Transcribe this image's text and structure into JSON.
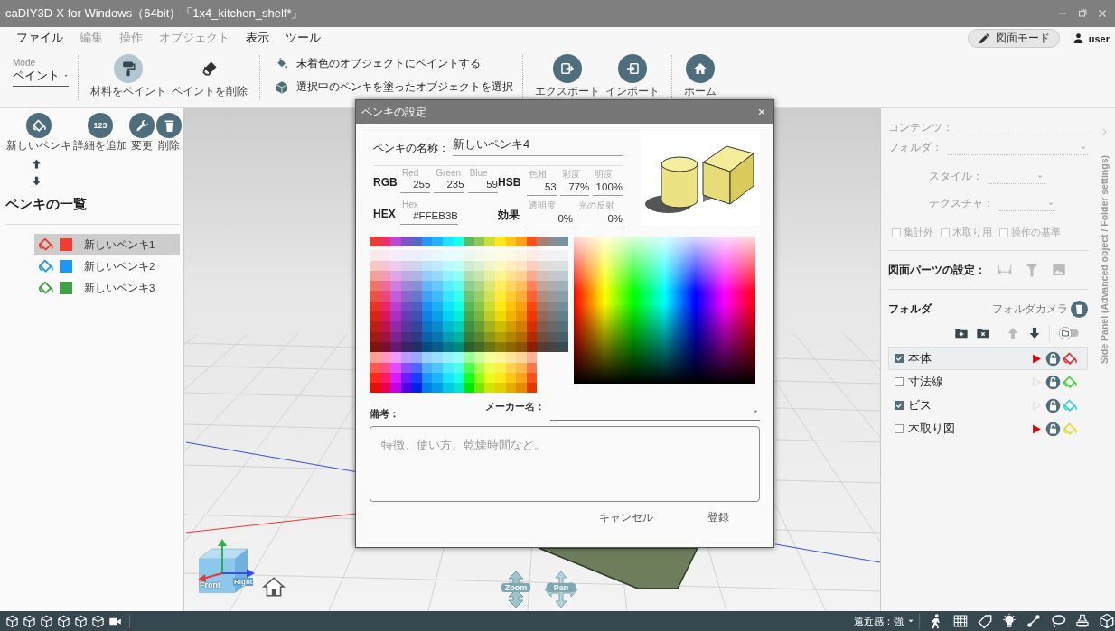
{
  "window": {
    "title": "caDIY3D-X for Windows（64bit）「1x4_kitchen_shelf*」"
  },
  "menu": [
    {
      "label": "ファイル",
      "disabled": false
    },
    {
      "label": "編集",
      "disabled": true
    },
    {
      "label": "操作",
      "disabled": true
    },
    {
      "label": "オブジェクト",
      "disabled": true
    },
    {
      "label": "表示",
      "disabled": false
    },
    {
      "label": "ツール",
      "disabled": false
    }
  ],
  "header_right": {
    "mode_button": "図面モード",
    "user": "user"
  },
  "toolbar": {
    "mode": {
      "label": "Mode",
      "value": "ペイント"
    },
    "paint_tools": [
      {
        "label": "材料をペイント",
        "selected": true
      },
      {
        "label": "ペイントを削除",
        "selected": false
      }
    ],
    "paint_actions": [
      "未着色のオブジェクトにペイントする",
      "選択中のペンキを塗ったオブジェクトを選択"
    ],
    "file_buttons": [
      "エクスポート",
      "インポート"
    ],
    "home_button": "ホーム"
  },
  "left_panel": {
    "actions": [
      {
        "kind": "new",
        "label": "新しいペンキ"
      },
      {
        "kind": "details",
        "label": "詳細を追加",
        "badge": "123"
      },
      {
        "kind": "edit",
        "label": "変更"
      },
      {
        "kind": "delete",
        "label": "削除"
      }
    ],
    "heading": "ペンキの一覧",
    "paints": [
      {
        "name": "新しいペンキ1",
        "color": "#f03c32",
        "selected": true
      },
      {
        "name": "新しいペンキ2",
        "color": "#2196f3",
        "selected": false
      },
      {
        "name": "新しいペンキ3",
        "color": "#43a047",
        "selected": false
      }
    ]
  },
  "viewport": {
    "nav_cube": {
      "front": "Front",
      "right": "Right"
    },
    "nav_buttons": [
      {
        "kind": "zoom",
        "label": "Zoom"
      },
      {
        "kind": "pan",
        "label": "Pan"
      }
    ]
  },
  "dialog": {
    "title": "ペンキの設定",
    "name_label": "ペンキの名称：",
    "name_value": "新しいペンキ4",
    "groups": [
      {
        "label": "RGB",
        "fields": [
          {
            "caption": "Red",
            "value": "255"
          },
          {
            "caption": "Green",
            "value": "235"
          },
          {
            "caption": "Blue",
            "value": "59"
          }
        ]
      },
      {
        "label": "HSB",
        "fields": [
          {
            "caption": "色相",
            "value": "53"
          },
          {
            "caption": "彩度",
            "value": "77%"
          },
          {
            "caption": "明度",
            "value": "100%"
          }
        ]
      },
      {
        "label": "HEX",
        "fields": [
          {
            "caption": "Hex",
            "value": "#FFEB3B"
          }
        ]
      },
      {
        "label": "効果",
        "fields": [
          {
            "caption": "透明度",
            "value": "0%"
          },
          {
            "caption": "光の反射",
            "value": "0%"
          }
        ]
      }
    ],
    "notes_label": "備考：",
    "maker_label": "メーカー名：",
    "notes_placeholder": "特徴、使い方、乾燥時間など。",
    "buttons": [
      "キャンセル",
      "登録"
    ]
  },
  "right_panel": {
    "title": "Side Panel (Advanced object / Folder settings)",
    "object_fields": [
      {
        "label": "コンテンツ：",
        "kind": "text",
        "disabled": true
      },
      {
        "label": "フォルダ：",
        "kind": "select",
        "disabled": true
      }
    ],
    "appearance_fields": [
      {
        "label": "スタイル：",
        "kind": "select",
        "disabled": true
      },
      {
        "label": "テクスチャ：",
        "kind": "select",
        "disabled": true
      }
    ],
    "options": [
      {
        "label": "集計外",
        "checked": false,
        "disabled": true
      },
      {
        "label": "木取り用",
        "checked": false,
        "disabled": true
      },
      {
        "label": "操作の基準",
        "checked": false,
        "disabled": true
      }
    ],
    "parts_label": "図面パーツの設定：",
    "folder": {
      "heading": "フォルダ",
      "camera_label": "フォルダカメラ",
      "view_toggle_on": false,
      "items": [
        {
          "name": "本体",
          "checked": true,
          "selected": true,
          "marker_filled": true,
          "color": "#e8262b"
        },
        {
          "name": "寸法線",
          "checked": false,
          "selected": false,
          "marker_filled": false,
          "color": "#3fd23a"
        },
        {
          "name": "ビス",
          "checked": true,
          "selected": false,
          "marker_filled": false,
          "color": "#2ad3dc"
        },
        {
          "name": "木取り図",
          "checked": false,
          "selected": false,
          "marker_filled": true,
          "color": "#e8d82a"
        }
      ]
    }
  },
  "status_bar": {
    "perspective": "遠近感：強"
  }
}
